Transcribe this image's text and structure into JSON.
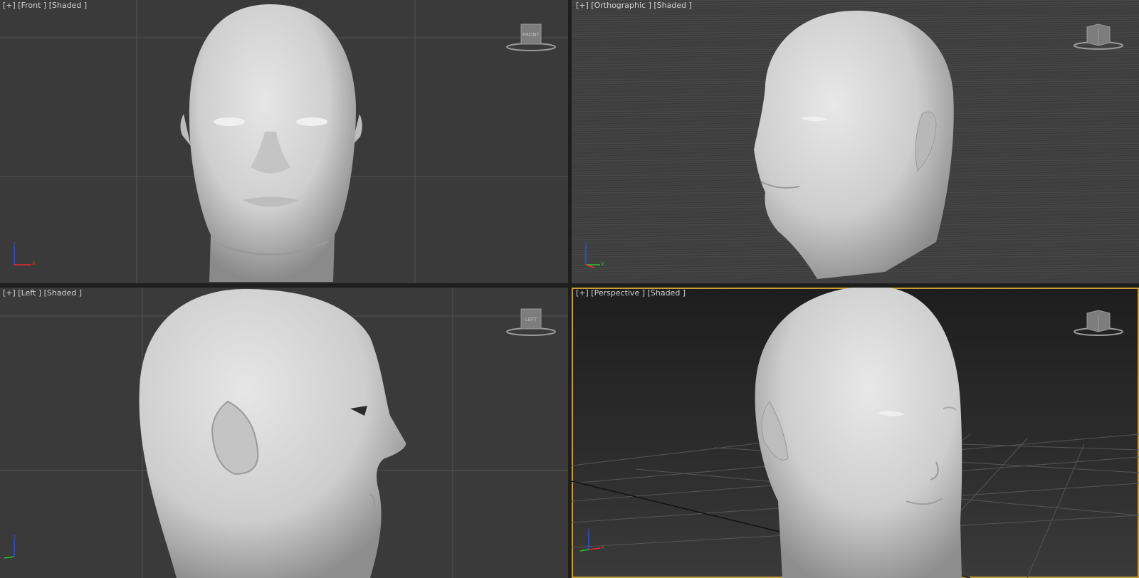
{
  "viewports": {
    "front": {
      "label": "[+] [Front ] [Shaded ]",
      "cube_label": "FRONT"
    },
    "ortho": {
      "label": "[+] [Orthographic ] [Shaded ]",
      "cube_label": ""
    },
    "left": {
      "label": "[+] [Left ] [Shaded ]",
      "cube_label": "LEFT"
    },
    "perspective": {
      "label": "[+] [Perspective ] [Shaded ]",
      "cube_label": ""
    }
  },
  "axis_labels": {
    "x": "x",
    "y": "y",
    "z": "z"
  },
  "colors": {
    "viewport_bg": "#3a3a3a",
    "grid": "#555555",
    "active_border": "#c8a038",
    "model": "#d6d6d6",
    "axis_x": "#e03030",
    "axis_y": "#30c030",
    "axis_z": "#3050e0"
  },
  "icons": [
    "viewcube-icon",
    "axis-tripod-icon"
  ]
}
